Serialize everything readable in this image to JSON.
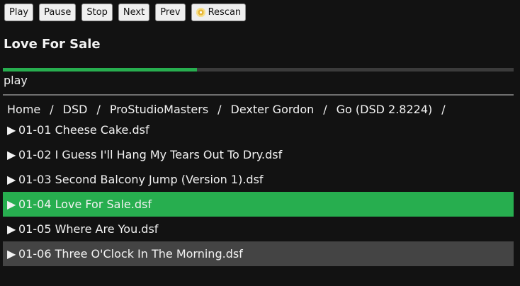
{
  "toolbar": {
    "play_label": "Play",
    "pause_label": "Pause",
    "stop_label": "Stop",
    "next_label": "Next",
    "prev_label": "Prev",
    "rescan_label": "Rescan",
    "rescan_icon": "disc-icon"
  },
  "now_playing": {
    "title": "Love For Sale",
    "status": "play",
    "progress_fraction": 0.38,
    "progress_color": "#27ae4f"
  },
  "breadcrumb": {
    "items": [
      "Home",
      "DSD",
      "ProStudioMasters",
      "Dexter Gordon",
      "Go (DSD 2.8224)"
    ],
    "separator": "/"
  },
  "files": {
    "play_glyph": "▶",
    "items": [
      {
        "name": "01-01 Cheese Cake.dsf"
      },
      {
        "name": "01-02 I Guess I'll Hang My Tears Out To Dry.dsf"
      },
      {
        "name": "01-03 Second Balcony Jump (Version 1).dsf"
      },
      {
        "name": "01-04 Love For Sale.dsf"
      },
      {
        "name": "01-05 Where Are You.dsf"
      },
      {
        "name": "01-06 Three O'Clock In The Morning.dsf"
      }
    ],
    "active_index": 3,
    "hover_index": 5
  },
  "colors": {
    "background": "#121212",
    "accent": "#27ae4f",
    "hover_row": "#444444"
  }
}
